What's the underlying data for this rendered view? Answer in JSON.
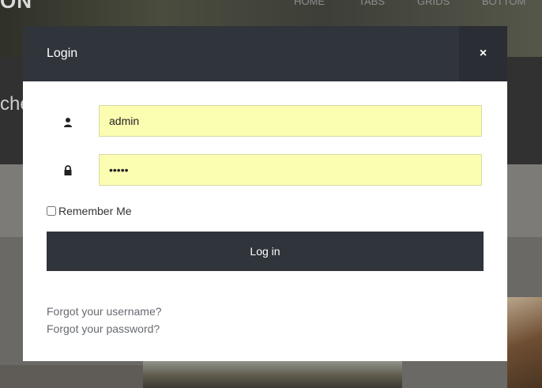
{
  "background": {
    "logo": "ON",
    "nav": [
      "HOME",
      "TABS",
      "GRIDS",
      "BOTTOM"
    ],
    "heading": "che"
  },
  "modal": {
    "title": "Login",
    "close_label": "×",
    "username": {
      "value": "admin",
      "icon": "user-icon"
    },
    "password": {
      "value": "•••••",
      "icon": "lock-icon"
    },
    "remember_label": "Remember Me",
    "remember_checked": false,
    "submit_label": "Log in",
    "forgot_username": "Forgot your username?",
    "forgot_password": "Forgot your password?"
  },
  "colors": {
    "header": "#30343b",
    "field_bg": "#fbfdb0",
    "button": "#30343b"
  }
}
